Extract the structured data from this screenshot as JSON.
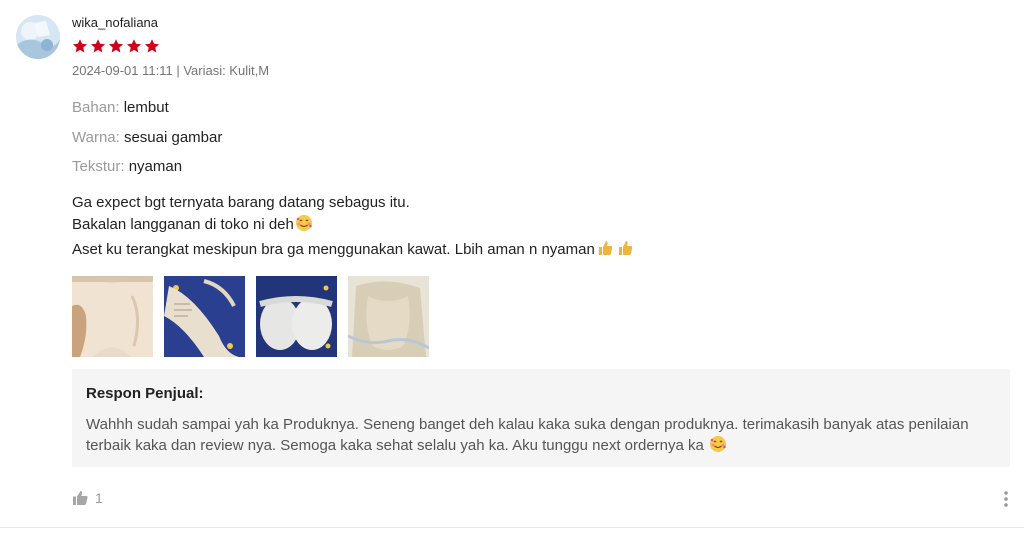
{
  "review": {
    "username": "wika_nofaliana",
    "avatar_icon": "profile-photo",
    "rating": 5,
    "rating_max": 5,
    "star_color": "#d0011b",
    "meta": "2024-09-01 11:11 | Variasi: Kulit,M",
    "attributes": [
      {
        "key": "Bahan:",
        "value": "lembut"
      },
      {
        "key": "Warna:",
        "value": "sesuai gambar"
      },
      {
        "key": "Tekstur:",
        "value": "nyaman"
      }
    ],
    "text_lines": [
      {
        "text": "Ga expect bgt ternyata barang datang sebagus itu.",
        "emoji": ""
      },
      {
        "text": "Bakalan langganan di toko ni deh",
        "emoji": "smiling-face-with-hearts"
      },
      {
        "text": "Aset ku terangkat meskipun bra ga menggunakan kawat. Lbih aman n nyaman",
        "emoji": "thumbs-up-x2"
      }
    ],
    "photos": [
      {
        "icon": "review-photo-1"
      },
      {
        "icon": "review-photo-2"
      },
      {
        "icon": "review-photo-3"
      },
      {
        "icon": "review-photo-4"
      }
    ]
  },
  "seller_response": {
    "title": "Respon Penjual:",
    "text": "Wahhh sudah sampai yah ka Produknya. Seneng banget deh kalau kaka suka dengan produknya. terimakasih banyak atas penilaian terbaik kaka dan review nya. Semoga kaka sehat selalu yah ka. Aku tunggu next ordernya ka",
    "emoji": "smiling-face-with-hearts",
    "background": "#f5f5f5"
  },
  "footer": {
    "like_icon": "thumbs-up-icon",
    "like_count": "1",
    "more_icon": "more-vertical-icon"
  }
}
